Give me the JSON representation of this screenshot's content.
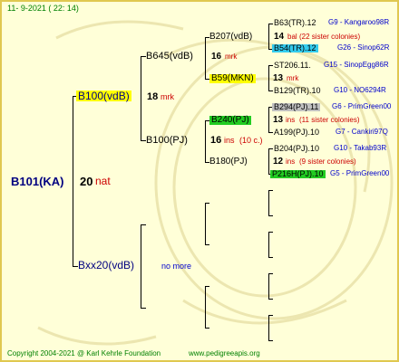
{
  "header": {
    "date": "11-  9-2021 (  22:  14)"
  },
  "colors": {
    "background": "#ffffd8",
    "frame": "#e0c850",
    "highlight_yellow": "#ffff00",
    "highlight_cyan": "#33ccee",
    "highlight_gray": "#c0c0c0",
    "highlight_green": "#22cc22",
    "red": "#cc0000",
    "blue": "#0000cc",
    "footer_green": "#008000"
  },
  "root": {
    "code": "B101(KA)",
    "num": "20",
    "ins": "nat"
  },
  "gen1": [
    {
      "code": "B100(vdB)",
      "num": "18",
      "ins": "mrk"
    },
    {
      "code": "Bxx20(vdB)",
      "note": "no more"
    }
  ],
  "gen2": [
    {
      "code": "B645(vdB)"
    },
    {
      "code": "B100(PJ)",
      "num": "16",
      "ins": "ins",
      "note": "(10 c.)"
    }
  ],
  "gen3": [
    {
      "code": "B207(vdB)",
      "num": "16",
      "ins": "mrk"
    },
    {
      "code": "B59(MKN)",
      "num": "13",
      "ins": "mrk"
    },
    {
      "code": "B240(PJ)",
      "num": "13",
      "ins": "ins",
      "note": "(11 sister colonies)"
    },
    {
      "code": "B180(PJ)",
      "num": "12",
      "ins": "ins",
      "note": "(9 sister colonies)"
    }
  ],
  "gen4": [
    {
      "code": "B63(TR).12",
      "ref": "G9 - Kangaroo98R"
    },
    {
      "code": "14",
      "ins": "bal",
      "note": "(22 sister colonies)"
    },
    {
      "code": "B54(TR).12",
      "ref": "G26 - Sinop62R"
    },
    {
      "code": "ST206.11.",
      "ref": "G15 - SinopEgg86R"
    },
    {
      "code": "B129(TR).10",
      "ref": "G10 - NO6294R"
    },
    {
      "code": "B294(PJ).11",
      "ref": "G6 - PrimGreen00"
    },
    {
      "code": "A199(PJ).10",
      "ref": "G7 - Cankiri97Q"
    },
    {
      "code": "B204(PJ).10",
      "ref": "G10 - Takab93R"
    },
    {
      "code": "P216H(PJ).10",
      "ref": "G5 - PrimGreen00"
    }
  ],
  "footer": {
    "copyright": "Copyright 2004-2021 @ Karl Kehrle Foundation",
    "url": "www.pedigreeapis.org"
  }
}
